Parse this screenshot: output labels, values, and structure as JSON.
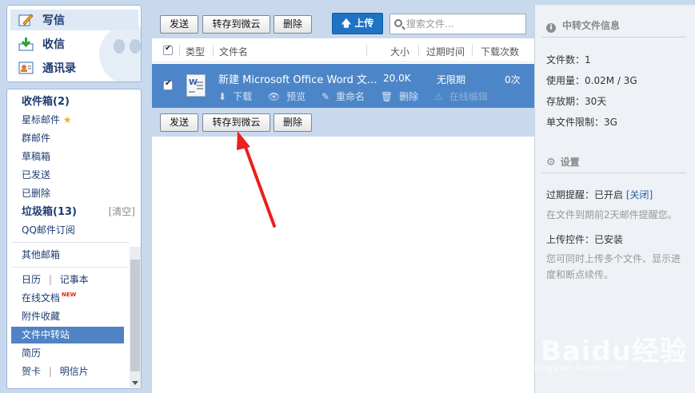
{
  "compose_buttons": [
    {
      "label": "写信",
      "icon": "pencil-icon"
    },
    {
      "label": "收信",
      "icon": "inbox-download-icon"
    },
    {
      "label": "通讯录",
      "icon": "contacts-icon"
    }
  ],
  "nav": {
    "inbox": "收件箱(2)",
    "starred": "星标邮件",
    "group": "群邮件",
    "drafts": "草稿箱",
    "sent": "已发送",
    "deleted": "已删除",
    "junk": "垃圾箱(13)",
    "junk_clear": "[清空]",
    "subscriptions": "QQ邮件订阅",
    "other_mailboxes": "其他邮箱",
    "calendar": "日历",
    "notes": "记事本",
    "online_docs": "在线文档",
    "online_docs_badge": "NEW",
    "attachments": "附件收藏",
    "file_transfer": "文件中转站",
    "resume": "简历",
    "cards": "贺卡",
    "postcards": "明信片",
    "divider": "|"
  },
  "toolbar": {
    "send": "发送",
    "save_to_weiyun": "转存到微云",
    "delete": "删除",
    "upload": "上传",
    "search_placeholder": "搜索文件..."
  },
  "table": {
    "headers": {
      "type": "类型",
      "filename": "文件名",
      "size": "大小",
      "expire": "过期时间",
      "downloads": "下载次数"
    },
    "rows": [
      {
        "name": "新建 Microsoft Office Word 文...",
        "size": "20.0K",
        "expire": "无限期",
        "downloads": "0次",
        "actions": [
          "下载",
          "预览",
          "重命名",
          "删除",
          "在线编辑"
        ]
      }
    ]
  },
  "right_panel": {
    "info_title": "中转文件信息",
    "file_count": "文件数：1",
    "usage": "使用量：0.02M / 3G",
    "retention": "存放期：30天",
    "single_limit": "单文件限制：3G",
    "settings_title": "设置",
    "expiry_reminder": "过期提醒：已开启",
    "expiry_close_link": "[关闭]",
    "expiry_desc": "在文件到期前2天邮件提醒您。",
    "upload_control": "上传控件：已安装",
    "upload_desc_1": "您可同时上传多个文件、显示进",
    "upload_desc_2": "度和断点续传。"
  },
  "watermark": {
    "logo": "Baidu经验",
    "url": "jingyan.baidu.com"
  },
  "colors": {
    "selected_row": "#4d86c8",
    "primary_button": "#1e73c4",
    "annotation_arrow": "#e8201e",
    "background": "#c8d9ee"
  }
}
